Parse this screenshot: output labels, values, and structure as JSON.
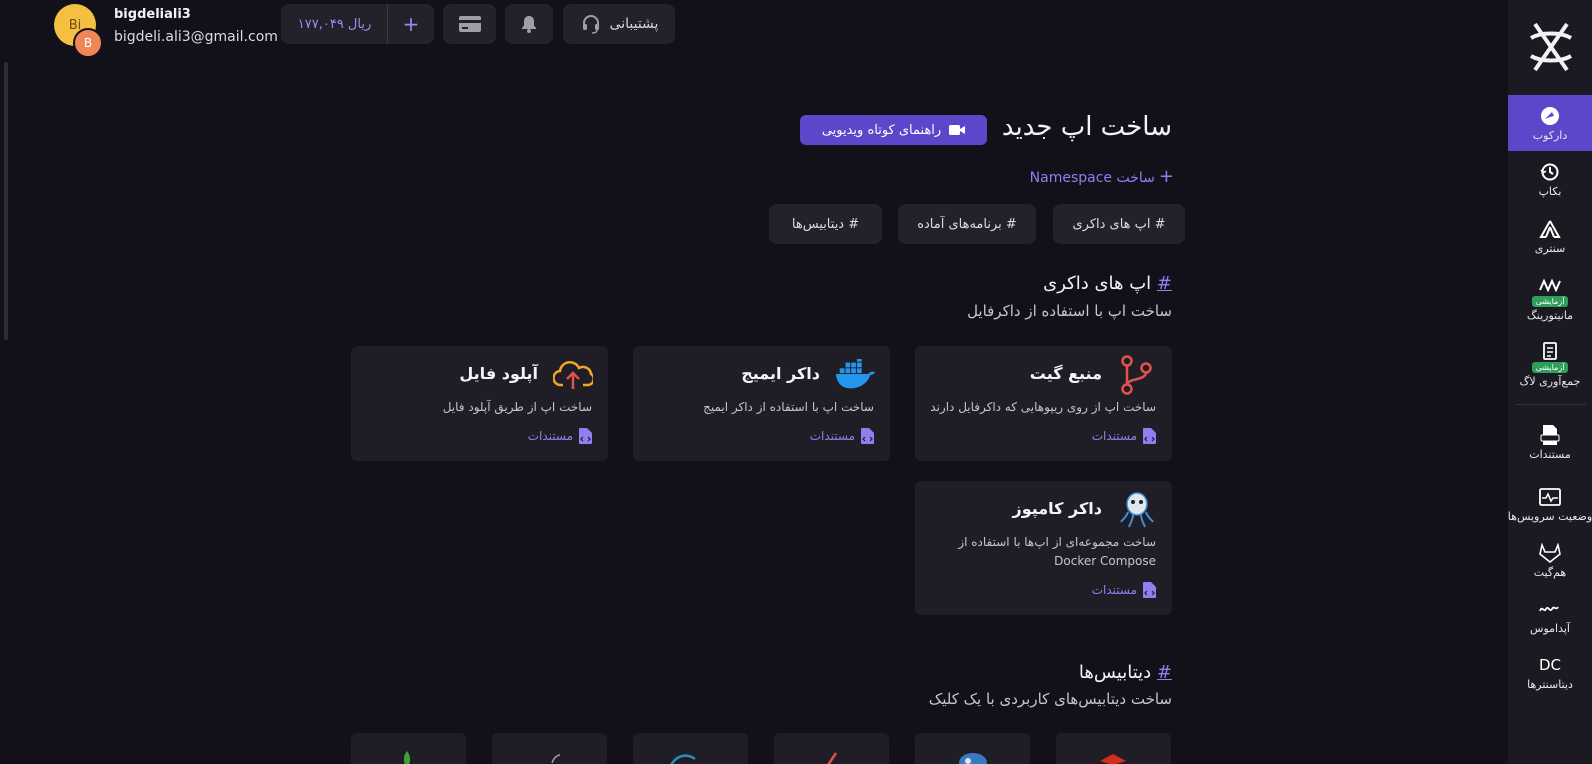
{
  "user": {
    "username": "bigdeliali3",
    "email": "bigdeli.ali3@gmail.com",
    "avatar_primary": "Bi",
    "avatar_secondary": "B"
  },
  "topbar": {
    "wallet_amount": "ریال ۱۷۷,۰۴۹",
    "add_credit": "+",
    "support_label": "پشتیبانی"
  },
  "sidebar": {
    "items": [
      {
        "label": "دارکوب",
        "icon": "darkube-icon",
        "active": true
      },
      {
        "label": "بکاپ",
        "icon": "backup-icon"
      },
      {
        "label": "سنتری",
        "icon": "sentry-icon"
      },
      {
        "label": "مانیتورینگ",
        "icon": "monitoring-icon",
        "badge": "آزمایشی"
      },
      {
        "label": "جمع‌آوری لاگ",
        "icon": "log-icon",
        "badge": "آزمایشی"
      },
      {
        "label": "مستندات",
        "icon": "docs-icon"
      },
      {
        "label": "وضعیت سرویس‌ها",
        "icon": "status-icon"
      },
      {
        "label": "هم‌گیت",
        "icon": "gitlab-icon"
      },
      {
        "label": "آپداموس",
        "icon": "uptime-icon"
      },
      {
        "label": "دیتاسنترها",
        "icon": "datacenter-icon",
        "icon_text": "DC"
      }
    ]
  },
  "main": {
    "title": "ساخت اپ جدید",
    "video_guide": "راهنمای کوتاه ویدیویی",
    "create_namespace": "ساخت Namespace",
    "chips": [
      "# اپ های داکری",
      "# برنامه‌های آماده",
      "# دیتابیس‌ها"
    ],
    "docker_section": {
      "hash": "#",
      "title": "اپ های داکری",
      "subtitle": "ساخت اپ با استفاده از داکرفایل"
    },
    "cards": [
      {
        "title": "منبع گیت",
        "desc": "ساخت اپ از روی ریپوهایی که داکرفایل دارند",
        "docs": "مستندات",
        "icon": "git-branch-icon"
      },
      {
        "title": "داکر ایمیج",
        "desc": "ساخت اپ با استفاده از داکر ایمیج",
        "docs": "مستندات",
        "icon": "docker-icon"
      },
      {
        "title": "آپلود فایل",
        "desc": "ساخت اپ از طریق آپلود فایل",
        "docs": "مستندات",
        "icon": "cloud-upload-icon"
      },
      {
        "title": "داکر کامپوز",
        "desc": "ساخت مجموعه‌ای از اپ‌ها با استفاده از Docker Compose",
        "docs": "مستندات",
        "icon": "docker-compose-icon"
      }
    ],
    "db_section": {
      "hash": "#",
      "title": "دیتابیس‌ها",
      "subtitle": "ساخت دیتابیس‌های کاربردی با یک کلیک"
    }
  },
  "colors": {
    "accent": "#5a47c9",
    "link": "#8f7ff0",
    "background": "#121119",
    "card": "#1f1e27"
  }
}
